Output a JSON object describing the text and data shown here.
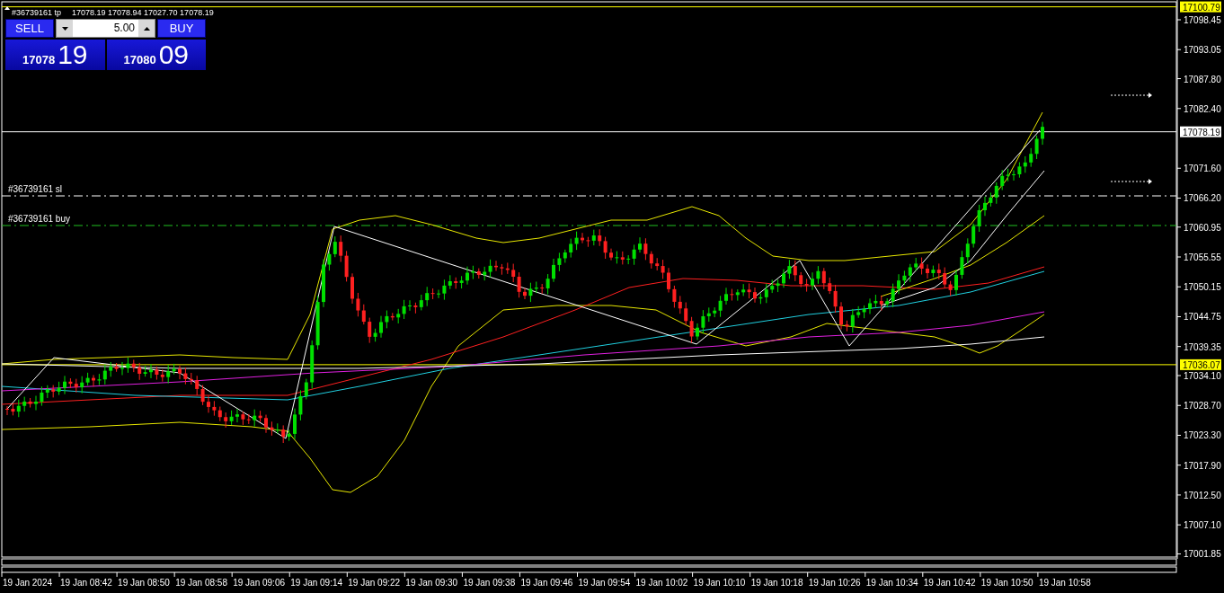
{
  "header": {
    "order_label": "#36739161 tp",
    "ohlc": "17078.19 17078.94 17027.70 17078.19"
  },
  "trade_panel": {
    "sell_label": "SELL",
    "buy_label": "BUY",
    "volume": "5.00",
    "sell_price": "17078",
    "sell_points": "19",
    "buy_price": "17080",
    "buy_points": "09"
  },
  "order_lines": [
    {
      "kind": "sl",
      "label": "#36739161 sl"
    },
    {
      "kind": "buy",
      "label": "#36739161 buy"
    }
  ],
  "price_axis": [
    "17098.45",
    "17093.05",
    "17087.80",
    "17082.40",
    "17071.60",
    "17066.20",
    "17060.95",
    "17055.55",
    "17050.15",
    "17044.75",
    "17039.35",
    "17034.10",
    "17028.70",
    "17023.30",
    "17017.90",
    "17012.50",
    "17007.10",
    "17001.85"
  ],
  "price_markers": [
    {
      "label": "17100.79",
      "color": "#ffff00"
    },
    {
      "label": "17078.19",
      "color": "#ffffff"
    },
    {
      "label": "17036.07",
      "color": "#ffff00"
    }
  ],
  "time_axis": [
    "19 Jan 2024",
    "19 Jan 08:42",
    "19 Jan 08:50",
    "19 Jan 08:58",
    "19 Jan 09:06",
    "19 Jan 09:14",
    "19 Jan 09:22",
    "19 Jan 09:30",
    "19 Jan 09:38",
    "19 Jan 09:46",
    "19 Jan 09:54",
    "19 Jan 10:02",
    "19 Jan 10:10",
    "19 Jan 10:18",
    "19 Jan 10:26",
    "19 Jan 10:34",
    "19 Jan 10:42",
    "19 Jan 10:50",
    "19 Jan 10:58"
  ]
}
